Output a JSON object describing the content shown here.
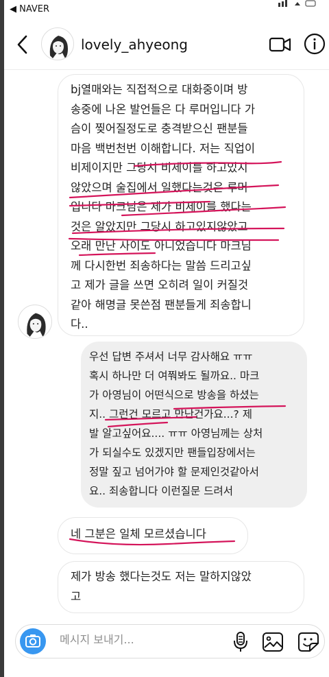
{
  "status_bar": {
    "back_app": "◀ NAVER"
  },
  "header": {
    "username": "lovely_ahyeong",
    "back_icon": "chevron-left-icon",
    "video_icon": "video-camera-icon",
    "info_icon": "info-icon"
  },
  "messages": [
    {
      "side": "received",
      "lines": [
        "bj열매와는 직접적으로 대화중이며 방",
        "송중에 나온 발언들은 다 루머입니다 가",
        "슴이 찢어질정도로 충격받으신 팬분들",
        "마음 백번천번 이해합니다. 저는 직업이",
        "비제이지만 그당시 비제이를 하고있지",
        "않았으며 술집에서 일했다는것은 루머",
        "입니다 마크님은 제가 비제이를 했다는",
        "것은 알았지만 그당시 하고있지않았고",
        "오래 만난 사이도 아니었습니다 마크님",
        "께 다시한번 죄송하다는 말씀 드리고싶",
        "고 제가 글을 쓰면 오히려 일이 커질것",
        "같아 해명글 못쓴점 팬분들게 죄송합니",
        "다.."
      ]
    },
    {
      "side": "sent",
      "lines": [
        "우선 답변 주셔서 너무 감사해요 ㅠㅠ",
        "혹시 하나만 더 여쭤봐도 될까요.. 마크",
        "가 아영님이 어떤식으로 방송을 하셨는",
        "지.. 그런건 모르고 만난건가요...? 제",
        "발 알고싶어요.... ㅠㅠ 아영님께는 상처",
        "가 되실수도 있겠지만 팬들입장에서는",
        "정말 짚고 넘어가야 할 문제인것같아서",
        "요.. 죄송합니다 이런질문 드려서"
      ]
    },
    {
      "side": "received",
      "lines": [
        "네 그분은 일체 모르셨습니다"
      ]
    },
    {
      "side": "received",
      "lines": [
        "제가 방송 했다는것도 저는 말하지않았",
        "고"
      ]
    }
  ],
  "composer": {
    "placeholder": "메시지 보내기...",
    "camera_icon": "camera-icon",
    "mic_icon": "microphone-icon",
    "gallery_icon": "image-gallery-icon",
    "sticker_icon": "sticker-icon"
  },
  "colors": {
    "annotation_underline": "#d4145a",
    "camera_button": "#3897f0",
    "sent_bubble": "#efefef"
  }
}
